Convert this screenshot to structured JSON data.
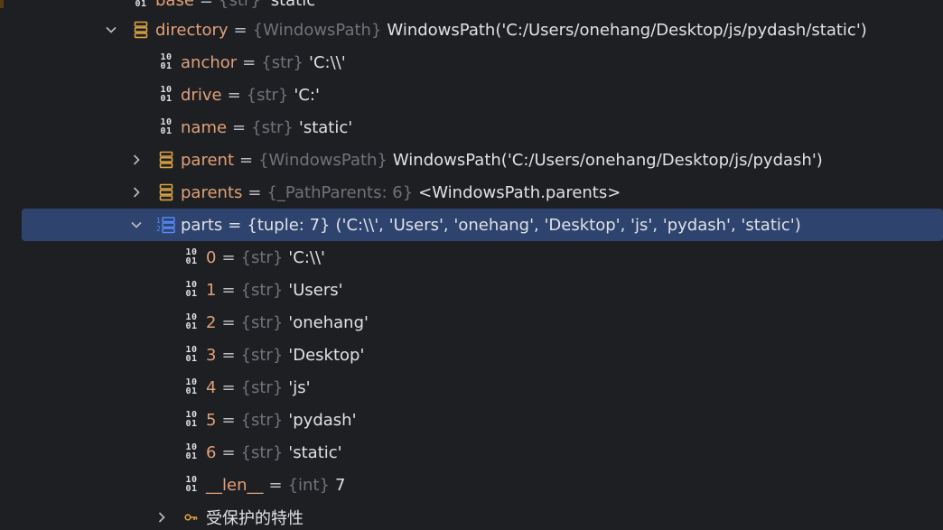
{
  "tree": {
    "rows": [
      {
        "name": "base",
        "type": "{str}",
        "value": "'static'",
        "icon": "binary-str-icon",
        "chevron": "none"
      },
      {
        "name": "directory",
        "type": "{WindowsPath}",
        "value": "WindowsPath('C:/Users/onehang/Desktop/js/pydash/static')",
        "icon": "object-stack-icon",
        "chevron": "expanded"
      },
      {
        "name": "anchor",
        "type": "{str}",
        "value": "'C:\\\\'",
        "icon": "binary-str-icon",
        "chevron": "none"
      },
      {
        "name": "drive",
        "type": "{str}",
        "value": "'C:'",
        "icon": "binary-str-icon",
        "chevron": "none"
      },
      {
        "name": "name",
        "type": "{str}",
        "value": "'static'",
        "icon": "binary-str-icon",
        "chevron": "none"
      },
      {
        "name": "parent",
        "type": "{WindowsPath}",
        "value": "WindowsPath('C:/Users/onehang/Desktop/js/pydash')",
        "icon": "object-stack-icon",
        "chevron": "collapsed"
      },
      {
        "name": "parents",
        "type": "{_PathParents: 6}",
        "value": "<WindowsPath.parents>",
        "icon": "object-stack-icon",
        "chevron": "collapsed"
      },
      {
        "name": "parts",
        "type": "{tuple: 7}",
        "value": "('C:\\\\', 'Users', 'onehang', 'Desktop', 'js', 'pydash', 'static')",
        "icon": "list-icon",
        "chevron": "expanded",
        "selected": true
      },
      {
        "name": "0",
        "type": "{str}",
        "value": "'C:\\\\'",
        "icon": "binary-str-icon",
        "chevron": "none"
      },
      {
        "name": "1",
        "type": "{str}",
        "value": "'Users'",
        "icon": "binary-str-icon",
        "chevron": "none"
      },
      {
        "name": "2",
        "type": "{str}",
        "value": "'onehang'",
        "icon": "binary-str-icon",
        "chevron": "none"
      },
      {
        "name": "3",
        "type": "{str}",
        "value": "'Desktop'",
        "icon": "binary-str-icon",
        "chevron": "none"
      },
      {
        "name": "4",
        "type": "{str}",
        "value": "'js'",
        "icon": "binary-str-icon",
        "chevron": "none"
      },
      {
        "name": "5",
        "type": "{str}",
        "value": "'pydash'",
        "icon": "binary-str-icon",
        "chevron": "none"
      },
      {
        "name": "6",
        "type": "{str}",
        "value": "'static'",
        "icon": "binary-str-icon",
        "chevron": "none"
      },
      {
        "name": "__len__",
        "type": "{int}",
        "value": "7",
        "icon": "binary-str-icon",
        "chevron": "none"
      },
      {
        "label": "受保护的特性",
        "icon": "key-icon",
        "chevron": "collapsed"
      }
    ]
  },
  "colors": {
    "background": "#1e1f22",
    "selection": "#2e436e",
    "variable_name": "#e0a079",
    "type_hint": "#6f737a",
    "value": "#dfe1e5",
    "object_icon": "#d9a343",
    "list_icon": "#548af7",
    "key_icon": "#d9a343"
  }
}
